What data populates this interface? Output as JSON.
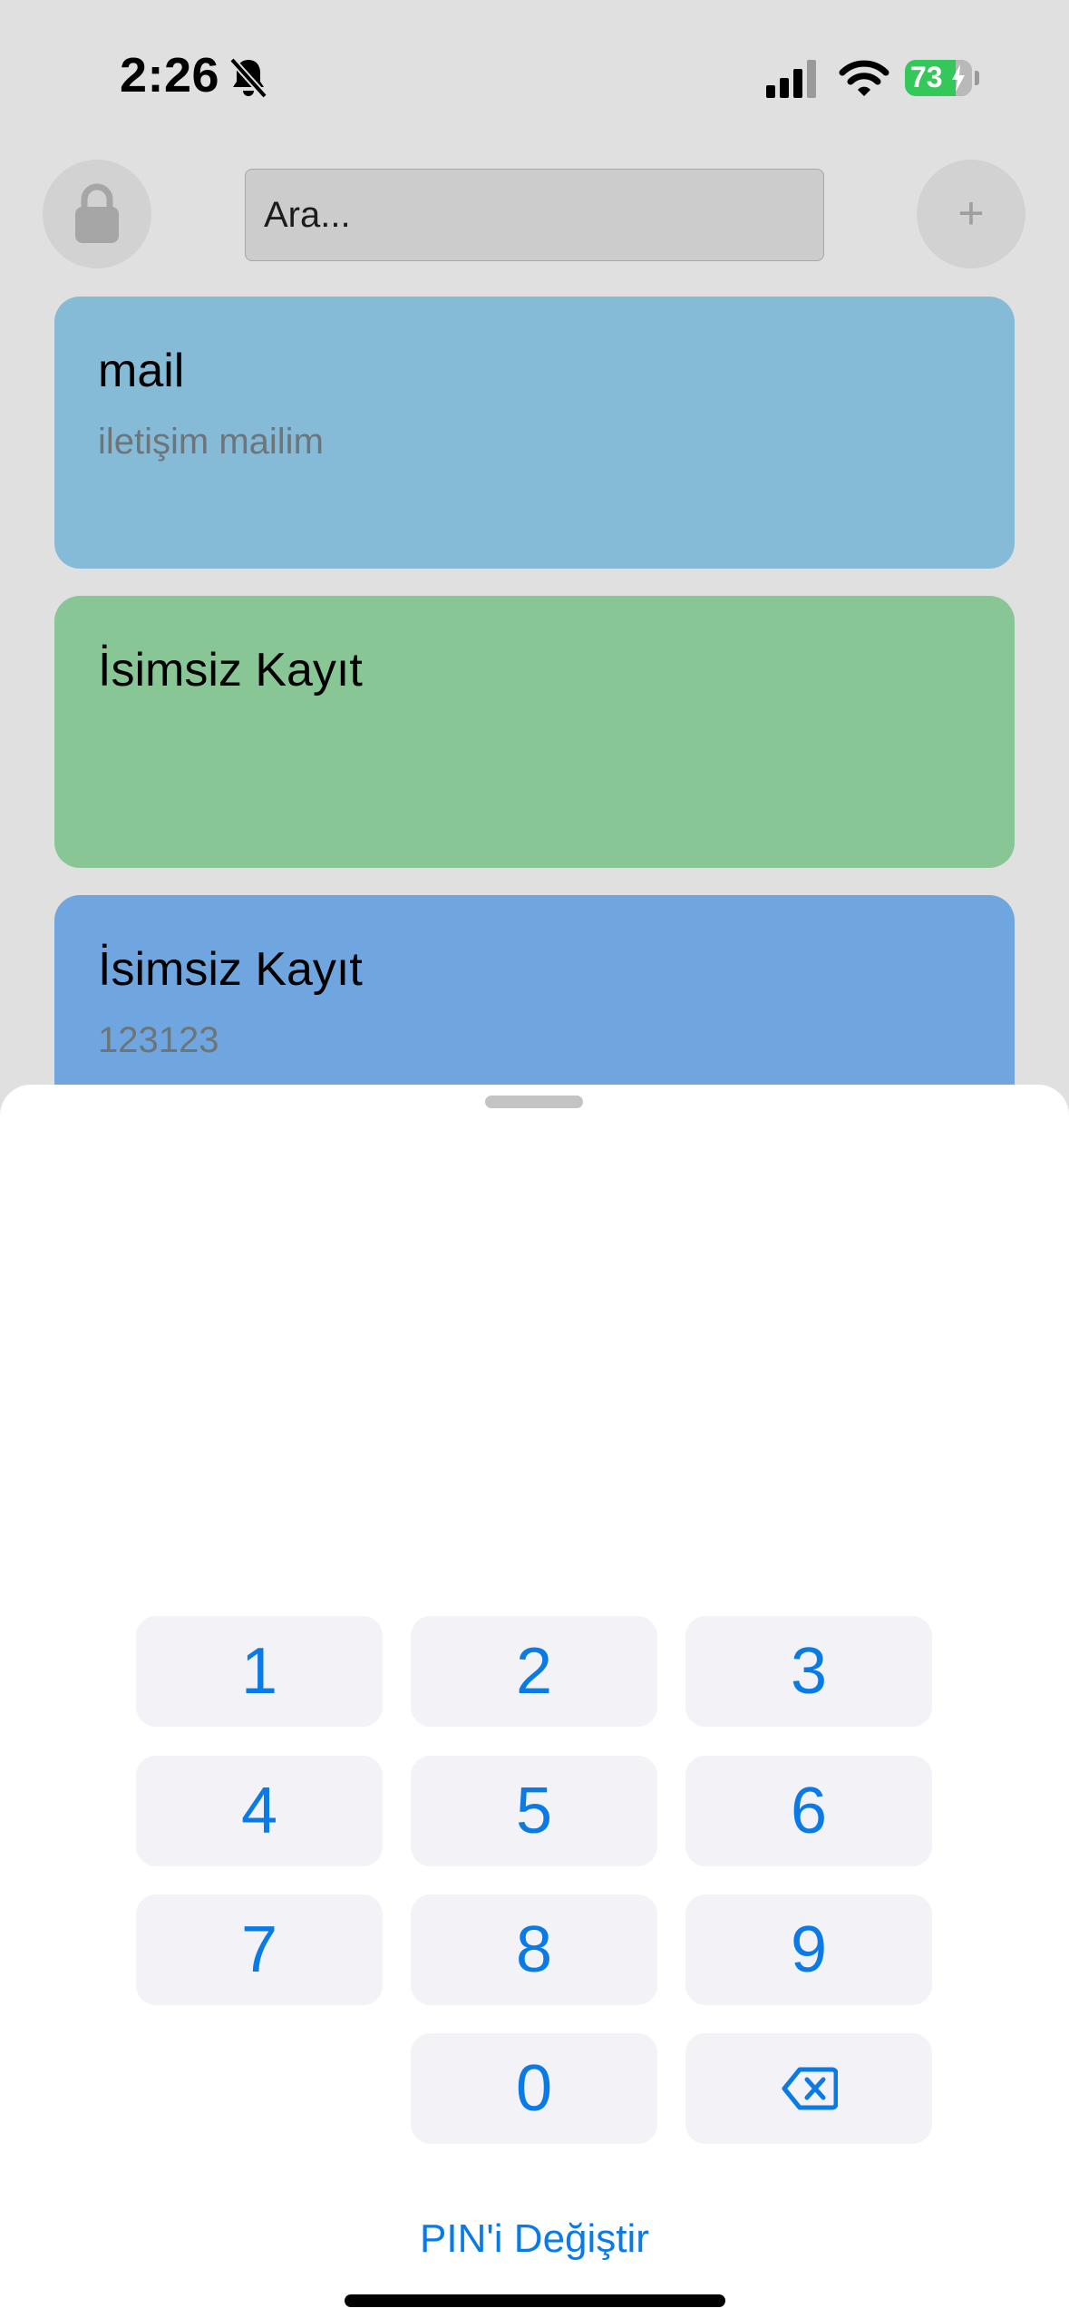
{
  "status_bar": {
    "time": "2:26",
    "battery_percent": "73",
    "battery_color": "#34c759"
  },
  "header": {
    "lock_icon": "lock-icon",
    "search_placeholder": "Ara...",
    "add_label": "+"
  },
  "notes": [
    {
      "title": "mail",
      "subtitle": "iletişim mailim",
      "color": "#86bbd8"
    },
    {
      "title": "İsimsiz Kayıt",
      "subtitle": "",
      "color": "#88c795"
    },
    {
      "title": "İsimsiz Kayıt",
      "subtitle": "123123",
      "color": "#70a6df"
    }
  ],
  "keypad": {
    "keys": [
      "1",
      "2",
      "3",
      "4",
      "5",
      "6",
      "7",
      "8",
      "9",
      "0"
    ],
    "delete_icon": "backspace-icon",
    "accent_color": "#0a7ae6"
  },
  "change_pin_label": "PIN'i Değiştir"
}
